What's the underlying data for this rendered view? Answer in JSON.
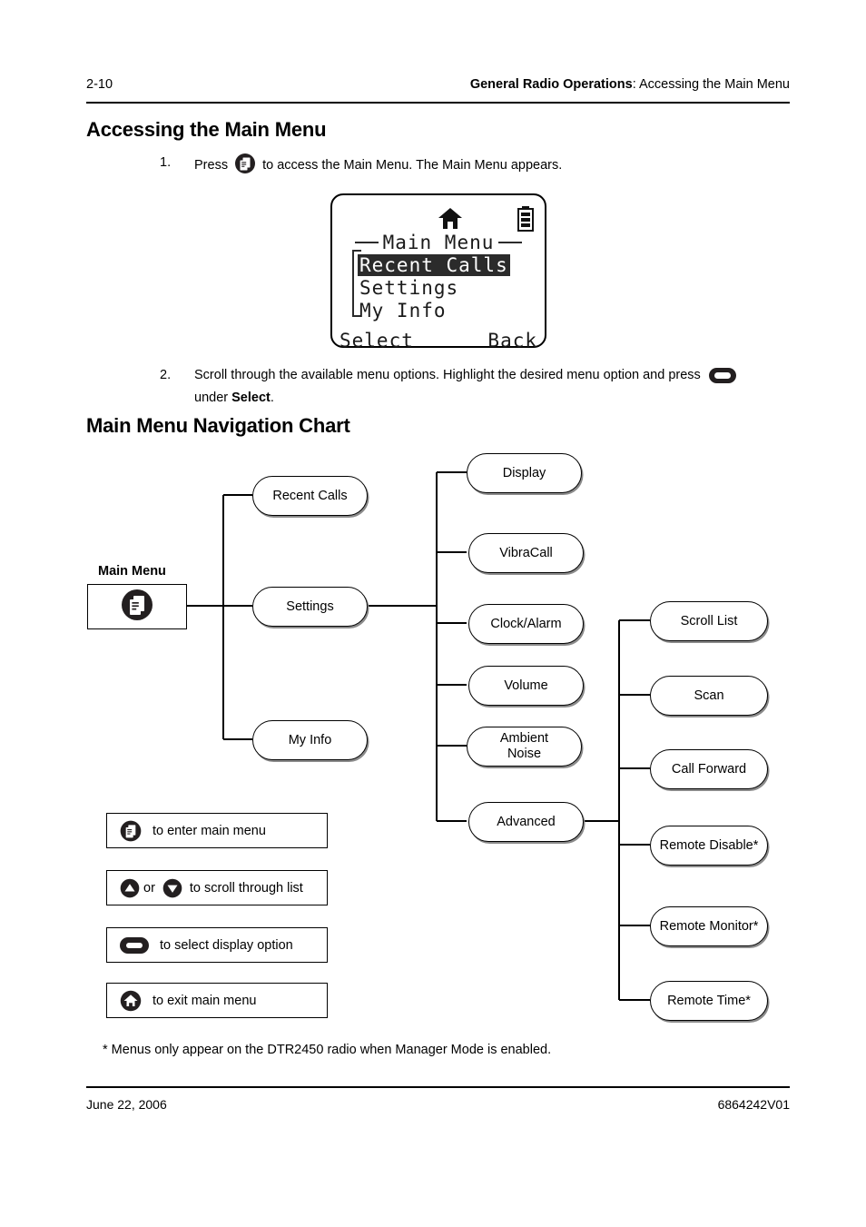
{
  "header": {
    "page_number": "2-10",
    "section_bold": "General Radio Operations",
    "section_rest": ": Accessing the Main Menu"
  },
  "headings": {
    "accessing": "Accessing the Main Menu",
    "nav_chart": "Main Menu Navigation Chart"
  },
  "steps": [
    {
      "number": "1.",
      "text_before": "Press",
      "icon": "menu-icon",
      "text_after": "to access the Main Menu. The Main Menu appears."
    },
    {
      "number": "2.",
      "text_before": "Scroll through the available menu options. Highlight the desired menu option and press",
      "icon": "select-key-icon",
      "text_after_bold": "Select",
      "text_after_lead": "under",
      "text_after_tail": "."
    }
  ],
  "radio_display": {
    "status_icons": [
      "home-icon",
      "battery-icon"
    ],
    "title": "Main Menu",
    "items": [
      "Recent Calls",
      "Settings",
      "My Info"
    ],
    "highlighted_item": "Recent Calls",
    "softkey_left": "Select",
    "softkey_right": "Back"
  },
  "nav_chart": {
    "root_label": "Main Menu",
    "root_icon": "menu-icon",
    "level1": [
      "Recent Calls",
      "Settings",
      "My Info"
    ],
    "level2": [
      "Display",
      "VibraCall",
      "Clock/Alarm",
      "Volume",
      "Ambient Noise",
      "Advanced"
    ],
    "level3": [
      "Scroll List",
      "Scan",
      "Call Forward",
      "Remote Disable*",
      "Remote Monitor*",
      "Remote Time*"
    ]
  },
  "legend": [
    {
      "icon": "menu-icon",
      "text": "to enter main menu"
    },
    {
      "icon": "up-down-arrow-icon",
      "text_or": "or",
      "text": "to scroll through list"
    },
    {
      "icon": "select-key-icon",
      "text": "to select display option"
    },
    {
      "icon": "home-icon",
      "text": "to exit main menu"
    }
  ],
  "footnote": "* Menus only appear on the DTR2450 radio when Manager Mode is enabled.",
  "footer": {
    "date": "June 22, 2006",
    "doc_id": "6864242V01"
  },
  "colors": {
    "ink": "#000000",
    "icon_fill": "#231f20",
    "lcd_text": "#1a1a1a",
    "pill_shadow": "#8a8a8a"
  }
}
